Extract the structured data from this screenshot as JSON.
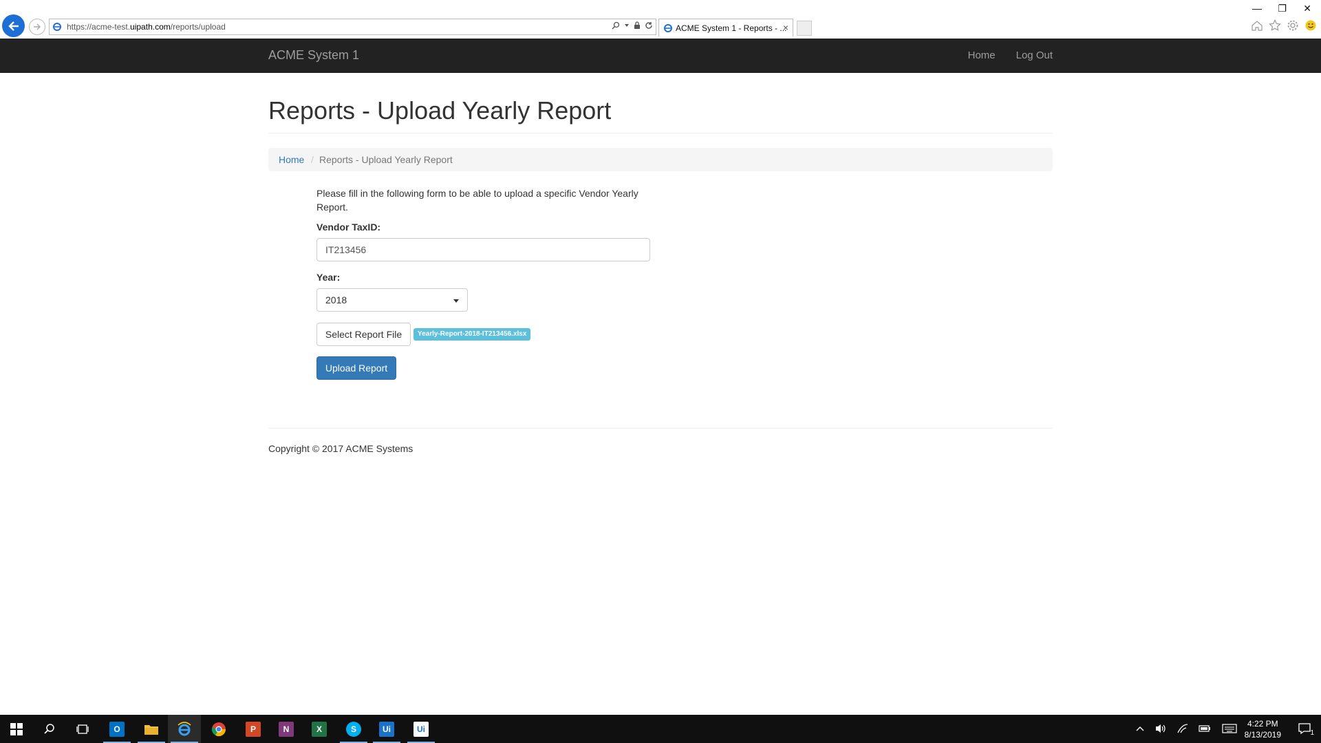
{
  "browser": {
    "url_prefix": "https://acme-test.",
    "url_domain": "uipath.com",
    "url_path": "/reports/upload",
    "tab_title": "ACME System 1 - Reports - ...",
    "tab_close": "×",
    "win_minimize": "—",
    "win_restore": "❐",
    "win_close": "✕"
  },
  "navbar": {
    "brand": "ACME System 1",
    "links": [
      "Home",
      "Log Out"
    ]
  },
  "page": {
    "title": "Reports - Upload Yearly Report",
    "breadcrumb": {
      "home": "Home",
      "separator": "/",
      "current": "Reports - Upload Yearly Report"
    },
    "intro": "Please fill in the following form to be able to upload a specific Vendor Yearly Report.",
    "form": {
      "taxid_label": "Vendor TaxID:",
      "taxid_value": "IT213456",
      "year_label": "Year:",
      "year_value": "2018",
      "select_file_label": "Select Report File",
      "selected_file": "Yearly-Report-2018-IT213456.xlsx",
      "upload_label": "Upload Report"
    },
    "copyright": "Copyright © 2017 ACME Systems"
  },
  "taskbar": {
    "time": "4:22 PM",
    "date": "8/13/2019",
    "apps": [
      "outlook",
      "file-explorer",
      "internet-explorer",
      "chrome",
      "powerpoint",
      "onenote",
      "excel",
      "skype",
      "uipath-studio",
      "uipath-robot"
    ],
    "app_letters": {
      "outlook": "O",
      "powerpoint": "P",
      "onenote": "N",
      "excel": "X",
      "skype": "S",
      "uipath-studio": "Ui",
      "uipath-robot": "Ui"
    },
    "colors": {
      "outlook": "#0072c6",
      "powerpoint": "#d24726",
      "onenote": "#80397b",
      "excel": "#217346",
      "skype": "#00aff0",
      "uipath": "#1a73c8"
    },
    "notification_count": "1"
  }
}
